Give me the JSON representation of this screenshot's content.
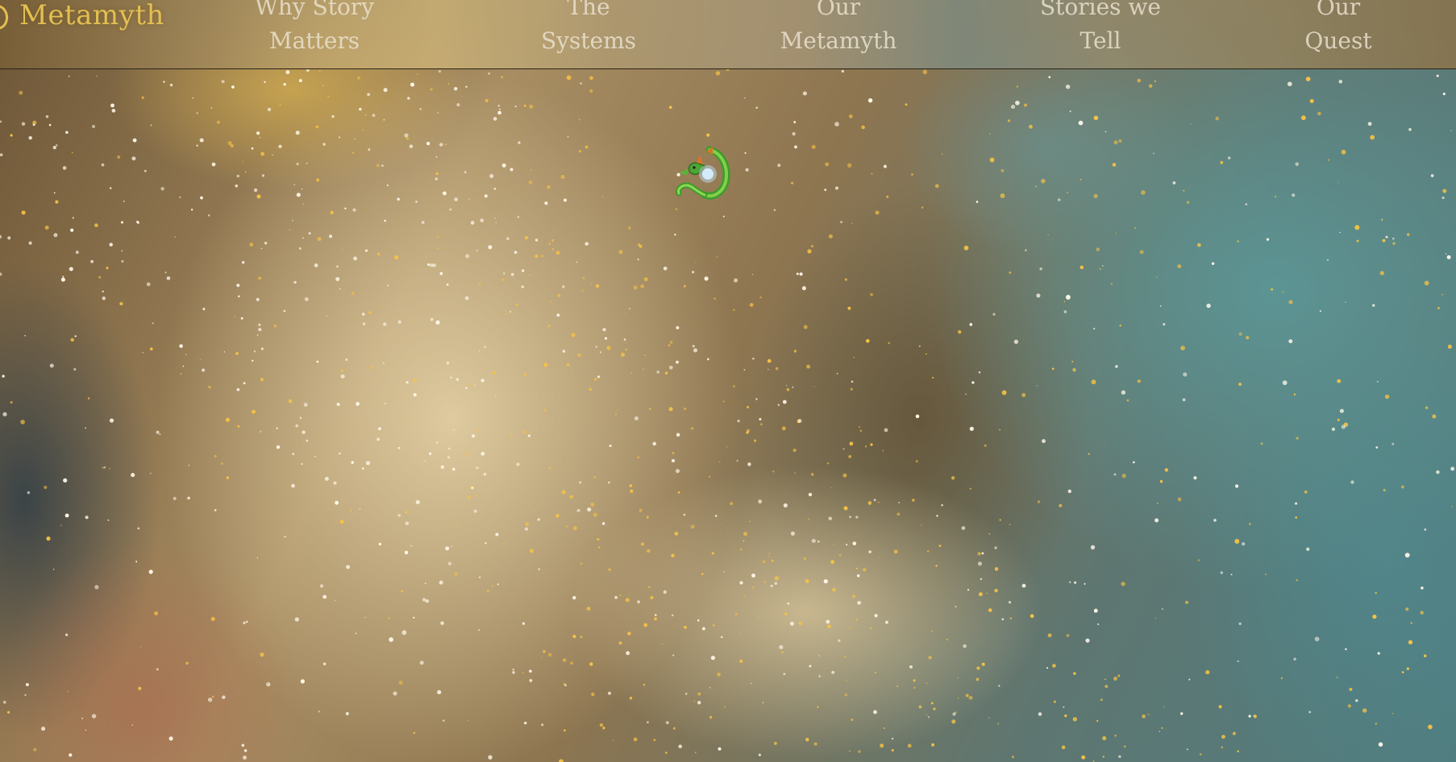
{
  "brand": {
    "name": "Metamyth",
    "logo_icon": "crescent-moon-icon",
    "color": "#e3bf52"
  },
  "nav": {
    "items": [
      {
        "line1": "Why Story",
        "line2": "Matters"
      },
      {
        "line1": "The",
        "line2": "Systems"
      },
      {
        "line1": "Our",
        "line2": "Metamyth"
      },
      {
        "line1": "Stories we",
        "line2": "Tell"
      },
      {
        "line1": "Our",
        "line2": "Quest"
      }
    ],
    "text_color": "#ece4d2"
  },
  "hero": {
    "background": "starry-nebula-icon",
    "emblem_icon": "green-dragon-icon"
  }
}
